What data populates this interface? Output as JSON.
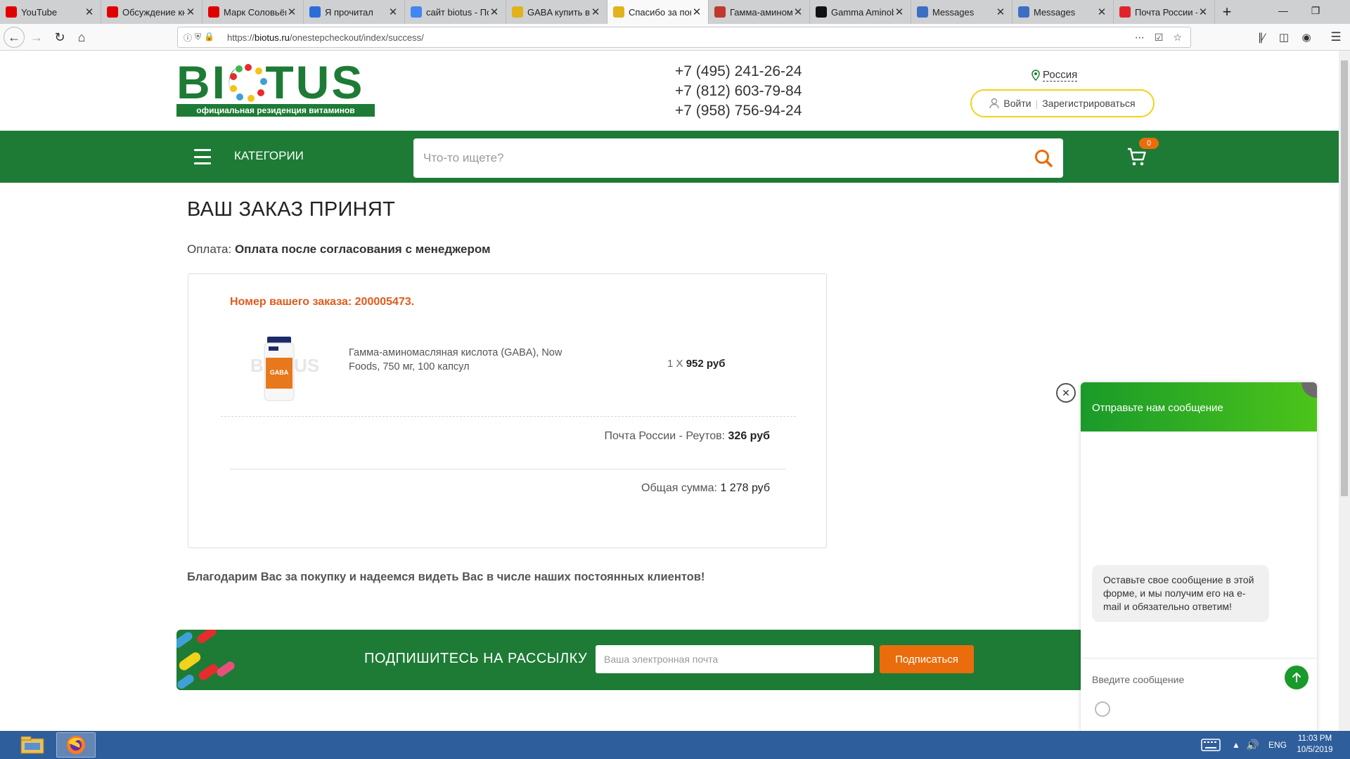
{
  "browser": {
    "tabs": [
      {
        "label": "YouTube",
        "icon": "youtube-icon",
        "color": "#e00000",
        "active": false
      },
      {
        "label": "Обсуждение кн",
        "icon": "youtube-icon",
        "color": "#e00000",
        "active": false
      },
      {
        "label": "Марк Соловьёв",
        "icon": "youtube-icon",
        "color": "#e00000",
        "active": false
      },
      {
        "label": "Я прочитал",
        "icon": "book-icon",
        "color": "#2a6edb",
        "active": false
      },
      {
        "label": "сайт biotus - По",
        "icon": "google-icon",
        "color": "#4285f4",
        "active": false
      },
      {
        "label": "GABA купить в",
        "icon": "biotus-icon",
        "color": "#e2b21d",
        "active": false
      },
      {
        "label": "Спасибо за пок",
        "icon": "biotus-icon",
        "color": "#e2b21d",
        "active": true
      },
      {
        "label": "Гамма-амином",
        "icon": "wiki-icon",
        "color": "#c0392b",
        "active": false
      },
      {
        "label": "Gamma Aminob",
        "icon": "examine-icon",
        "color": "#111111",
        "active": false
      },
      {
        "label": "Messages",
        "icon": "messages-icon",
        "color": "#3c6fc2",
        "active": false
      },
      {
        "label": "Messages",
        "icon": "messages-icon",
        "color": "#3c6fc2",
        "active": false
      },
      {
        "label": "Почта России -",
        "icon": "map-pin-icon",
        "color": "#e0242b",
        "active": false
      }
    ],
    "url_prefix": "https://",
    "url_host": "biotus.ru",
    "url_path": "/onestepcheckout/index/success/"
  },
  "header": {
    "logo_text": "BIOTUS",
    "logo_subtitle": "официальная резиденция витаминов",
    "phones": [
      "+7 (495) 241-26-24",
      "+7 (812) 603-79-84",
      "+7 (958) 756-94-24"
    ],
    "region": "Россия",
    "login": "Войти",
    "register": "Зарегистрироваться"
  },
  "navbar": {
    "categories": "КАТЕГОРИИ",
    "search_placeholder": "Что-то ищете?",
    "cart_count": "0"
  },
  "order": {
    "title": "ВАШ ЗАКАЗ ПРИНЯТ",
    "payment_label": "Оплата:",
    "payment_value": "Оплата после согласования с менеджером",
    "number_text": "Номер вашего заказа: 200005473.",
    "product_name": "Гамма-аминомасляная кислота (GABA), Now Foods, 750 мг, 100 капсул",
    "qty": "1 X",
    "price": "952 руб",
    "delivery_label": "Почта России - Реутов:",
    "delivery_price": "326 руб",
    "total_label": "Общая сумма:",
    "total_value": "1 278 руб",
    "product_image_label": "GABA",
    "product_watermark": "BIOTUS"
  },
  "thanks": "Благодарим Вас за покупку и надеемся видеть Вас в числе наших постоянных клиентов!",
  "newsletter": {
    "title": "ПОДПИШИТЕСЬ НА РАССЫЛКУ",
    "placeholder": "Ваша электронная почта",
    "button": "Подписаться"
  },
  "chat": {
    "header": "Отправьте нам сообщение",
    "bubble": "Оставьте свое сообщение в этой форме, и мы получим его на e-mail и обязательно ответим!",
    "input_placeholder": "Введите сообщение"
  },
  "taskbar": {
    "lang": "ENG",
    "time": "11:03 PM",
    "date": "10/5/2019"
  },
  "colors": {
    "brand_green": "#1d7b35",
    "accent_orange": "#ea6c0c",
    "order_number": "#e05a1c"
  }
}
